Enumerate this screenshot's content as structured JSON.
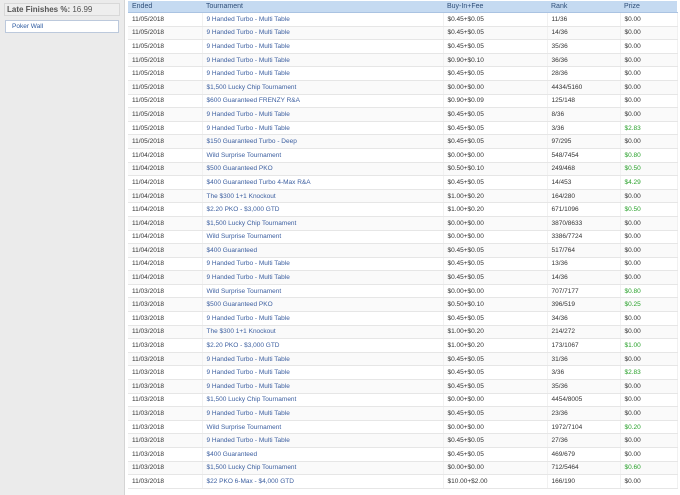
{
  "sidebar": {
    "late_finishes_label": "Late Finishes %:",
    "late_finishes_value": "16.99",
    "poker_wall_label": "Poker Wall"
  },
  "table": {
    "headers": [
      "Ended",
      "Tournament",
      "Buy-In+Fee",
      "Rank",
      "Prize"
    ],
    "rows": [
      [
        "11/05/2018",
        "9 Handed Turbo - Multi Table",
        "$0.45+$0.05",
        "11/36",
        "$0.00"
      ],
      [
        "11/05/2018",
        "9 Handed Turbo - Multi Table",
        "$0.45+$0.05",
        "14/36",
        "$0.00"
      ],
      [
        "11/05/2018",
        "9 Handed Turbo - Multi Table",
        "$0.45+$0.05",
        "35/36",
        "$0.00"
      ],
      [
        "11/05/2018",
        "9 Handed Turbo - Multi Table",
        "$0.90+$0.10",
        "36/36",
        "$0.00"
      ],
      [
        "11/05/2018",
        "9 Handed Turbo - Multi Table",
        "$0.45+$0.05",
        "28/36",
        "$0.00"
      ],
      [
        "11/05/2018",
        "$1,500 Lucky Chip Tournament",
        "$0.00+$0.00",
        "4434/5160",
        "$0.00"
      ],
      [
        "11/05/2018",
        "$600 Guaranteed FRENZY R&A",
        "$0.90+$0.09",
        "125/148",
        "$0.00"
      ],
      [
        "11/05/2018",
        "9 Handed Turbo - Multi Table",
        "$0.45+$0.05",
        "8/36",
        "$0.00"
      ],
      [
        "11/05/2018",
        "9 Handed Turbo - Multi Table",
        "$0.45+$0.05",
        "3/36",
        "$2.83"
      ],
      [
        "11/05/2018",
        "$150 Guaranteed Turbo - Deep",
        "$0.45+$0.05",
        "97/295",
        "$0.00"
      ],
      [
        "11/04/2018",
        "Wild Surprise Tournament",
        "$0.00+$0.00",
        "548/7454",
        "$0.80"
      ],
      [
        "11/04/2018",
        "$500 Guaranteed PKO",
        "$0.50+$0.10",
        "249/468",
        "$0.50"
      ],
      [
        "11/04/2018",
        "$400 Guaranteed Turbo 4-Max R&A",
        "$0.45+$0.05",
        "14/453",
        "$4.29"
      ],
      [
        "11/04/2018",
        "The $300 1+1 Knockout",
        "$1.00+$0.20",
        "164/280",
        "$0.00"
      ],
      [
        "11/04/2018",
        "$2.20 PKO - $3,000 GTD",
        "$1.00+$0.20",
        "671/1096",
        "$0.50"
      ],
      [
        "11/04/2018",
        "$1,500 Lucky Chip Tournament",
        "$0.00+$0.00",
        "3870/8633",
        "$0.00"
      ],
      [
        "11/04/2018",
        "Wild Surprise Tournament",
        "$0.00+$0.00",
        "3386/7724",
        "$0.00"
      ],
      [
        "11/04/2018",
        "$400 Guaranteed",
        "$0.45+$0.05",
        "517/764",
        "$0.00"
      ],
      [
        "11/04/2018",
        "9 Handed Turbo - Multi Table",
        "$0.45+$0.05",
        "13/36",
        "$0.00"
      ],
      [
        "11/04/2018",
        "9 Handed Turbo - Multi Table",
        "$0.45+$0.05",
        "14/36",
        "$0.00"
      ],
      [
        "11/03/2018",
        "Wild Surprise Tournament",
        "$0.00+$0.00",
        "707/7177",
        "$0.80"
      ],
      [
        "11/03/2018",
        "$500 Guaranteed PKO",
        "$0.50+$0.10",
        "396/519",
        "$0.25"
      ],
      [
        "11/03/2018",
        "9 Handed Turbo - Multi Table",
        "$0.45+$0.05",
        "34/36",
        "$0.00"
      ],
      [
        "11/03/2018",
        "The $300 1+1 Knockout",
        "$1.00+$0.20",
        "214/272",
        "$0.00"
      ],
      [
        "11/03/2018",
        "$2.20 PKO - $3,000 GTD",
        "$1.00+$0.20",
        "173/1067",
        "$1.00"
      ],
      [
        "11/03/2018",
        "9 Handed Turbo - Multi Table",
        "$0.45+$0.05",
        "31/36",
        "$0.00"
      ],
      [
        "11/03/2018",
        "9 Handed Turbo - Multi Table",
        "$0.45+$0.05",
        "3/36",
        "$2.83"
      ],
      [
        "11/03/2018",
        "9 Handed Turbo - Multi Table",
        "$0.45+$0.05",
        "35/36",
        "$0.00"
      ],
      [
        "11/03/2018",
        "$1,500 Lucky Chip Tournament",
        "$0.00+$0.00",
        "4454/8005",
        "$0.00"
      ],
      [
        "11/03/2018",
        "9 Handed Turbo - Multi Table",
        "$0.45+$0.05",
        "23/36",
        "$0.00"
      ],
      [
        "11/03/2018",
        "Wild Surprise Tournament",
        "$0.00+$0.00",
        "1972/7104",
        "$0.20"
      ],
      [
        "11/03/2018",
        "9 Handed Turbo - Multi Table",
        "$0.45+$0.05",
        "27/36",
        "$0.00"
      ],
      [
        "11/03/2018",
        "$400 Guaranteed",
        "$0.45+$0.05",
        "469/679",
        "$0.00"
      ],
      [
        "11/03/2018",
        "$1,500 Lucky Chip Tournament",
        "$0.00+$0.00",
        "712/5464",
        "$0.60"
      ],
      [
        "11/03/2018",
        "$22 PKO 6-Max - $4,000 GTD",
        "$10.00+$2.00",
        "166/190",
        "$0.00"
      ]
    ]
  },
  "colors": {
    "header_bg": "#c5daf1",
    "link": "#3c5fa0",
    "prize_win": "#29a12b"
  }
}
